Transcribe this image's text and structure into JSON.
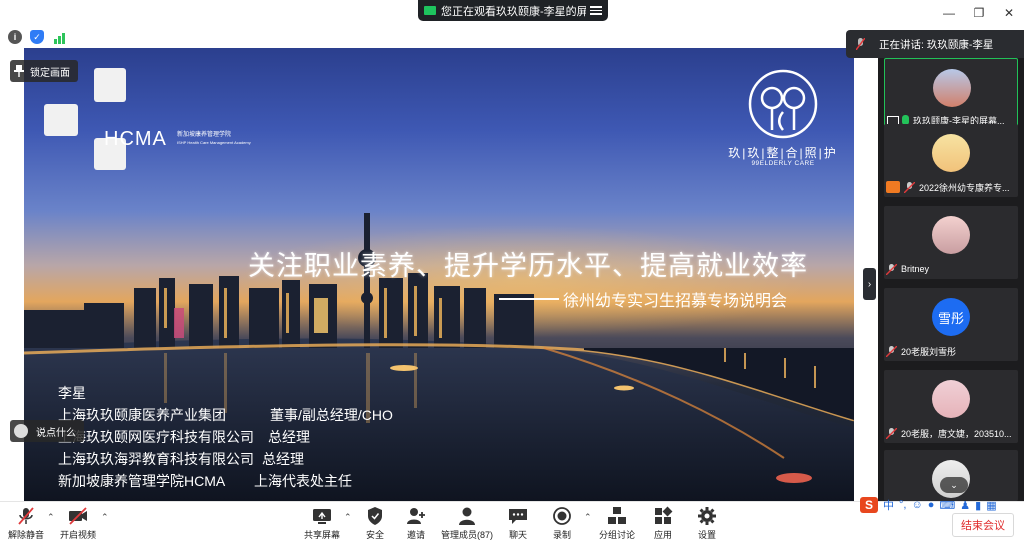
{
  "titlebar": {
    "share_notice": "您正在观看玖玖颐康-李星的屏幕"
  },
  "stage": {
    "hcma_logo_text": "HCMA",
    "hcma_sub_cn": "新加坡康养管理学院",
    "hcma_sub_en": "ISHP Health Care Management Academy",
    "brand_cn": "玖|玖|整|合|照|护",
    "brand_en": "99ELDERLY CARE",
    "headline": "关注职业素养、提升学历水平、提高就业效率",
    "subline": "徐州幼专实习生招募专场说明会",
    "speaker_name": "李星",
    "roles": [
      {
        "org": "上海玖玖颐康医养产业集团",
        "title": "董事/副总经理/CHO"
      },
      {
        "org": "上海玖玖颐网医疗科技有限公司",
        "title": "总经理"
      },
      {
        "org": "上海玖玖海羿教育科技有限公司",
        "title": "总经理"
      },
      {
        "org": "新加坡康养管理学院HCMA",
        "title": "上海代表处主任"
      }
    ],
    "lock_label": "锁定画面",
    "chat_label": "说点什么"
  },
  "panel": {
    "speaking_label": "正在讲话: 玖玖颐康-李星",
    "participants": [
      {
        "name": "玖玖颐康-李星的屏幕..."
      },
      {
        "name": "2022徐州幼专康养专..."
      },
      {
        "name": "Britney"
      },
      {
        "name": "20老服刘雪彤",
        "avatar_text": "雪彤"
      },
      {
        "name": "20老服，唐文婕，203510..."
      },
      {
        "name": ""
      }
    ]
  },
  "toolbar": {
    "unmute": "解除静音",
    "start_video": "开启视频",
    "share_screen": "共享屏幕",
    "security": "安全",
    "invite": "邀请",
    "manage_members": "管理成员(87)",
    "chat": "聊天",
    "record": "录制",
    "breakout": "分组讨论",
    "apps": "应用",
    "settings": "设置",
    "end_meeting": "结束会议"
  },
  "ime": {
    "lang": "中",
    "punct": "°,"
  },
  "colors": {
    "accent_green": "#21c158",
    "end_red": "#e02b2b",
    "panel_bg": "#1c1c1e"
  }
}
